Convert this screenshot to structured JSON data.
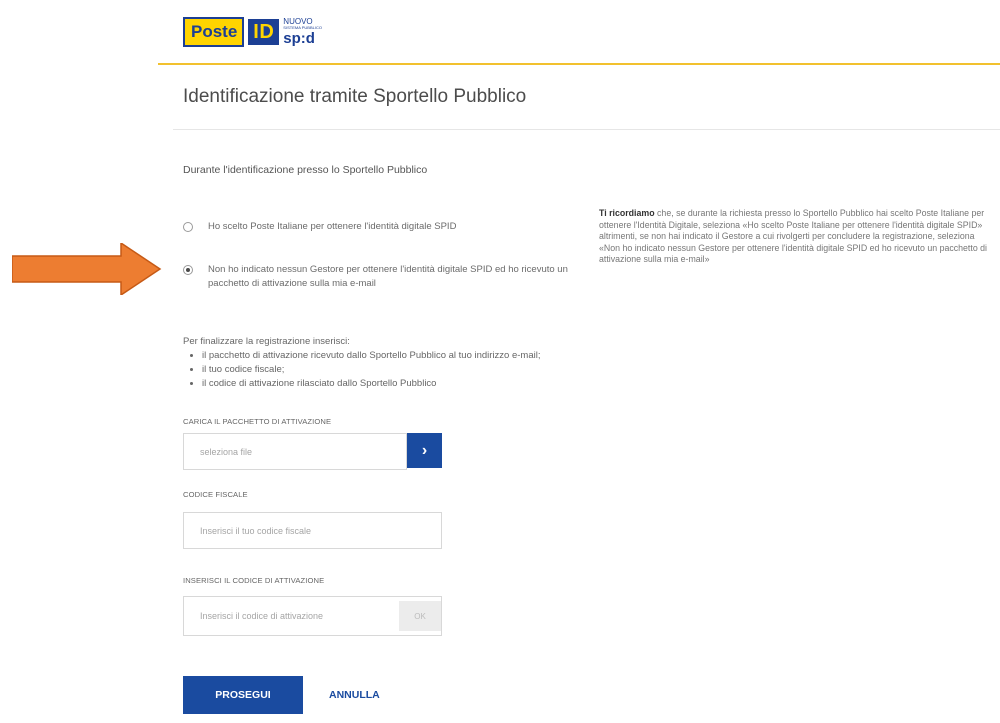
{
  "logo": {
    "poste": "Poste",
    "id": "ID",
    "nuovo": "NUOVO",
    "mini": "SISTEMA PUBBLICO",
    "spid": "sp:d"
  },
  "page_title": "Identificazione tramite Sportello Pubblico",
  "section_label": "Durante l'identificazione presso lo Sportello Pubblico",
  "options": [
    {
      "label": "Ho scelto Poste Italiane per ottenere l'identità digitale SPID",
      "checked": false
    },
    {
      "label": "Non ho indicato nessun Gestore per ottenere l'identità digitale SPID ed ho ricevuto un pacchetto di attivazione sulla mia e-mail",
      "checked": true
    }
  ],
  "note": {
    "bold": "Ti ricordiamo",
    "text": " che, se durante la richiesta presso lo Sportello Pubblico hai scelto Poste Italiane per ottenere l'Identità Digitale, seleziona «Ho scelto Poste Italiane per ottenere l'identità digitale SPID» altrimenti, se non hai indicato il Gestore a cui rivolgerti per concludere la registrazione, seleziona «Non ho indicato nessun Gestore per ottenere l'identità digitale SPID ed ho ricevuto un pacchetto di attivazione sulla mia e-mail»"
  },
  "instructions": {
    "intro": "Per finalizzare la registrazione inserisci:",
    "items": [
      "il pacchetto di attivazione ricevuto dallo Sportello Pubblico al tuo indirizzo e-mail;",
      "il tuo codice fiscale;",
      "il codice di attivazione rilasciato dallo Sportello Pubblico"
    ]
  },
  "fields": {
    "package": {
      "label": "CARICA IL PACCHETTO DI ATTIVAZIONE",
      "placeholder": "seleziona file"
    },
    "fiscal_code": {
      "label": "CODICE FISCALE",
      "placeholder": "Inserisci il tuo codice fiscale"
    },
    "activation_code": {
      "label": "INSERISCI IL CODICE DI ATTIVAZIONE",
      "placeholder": "Inserisci il codice di attivazione",
      "badge": "OK"
    }
  },
  "buttons": {
    "proceed": "PROSEGUI",
    "cancel": "ANNULLA"
  },
  "colors": {
    "brand_blue": "#1a4ba0",
    "accent_yellow": "#ffd400",
    "annotation_arrow": "#ed7d31"
  }
}
